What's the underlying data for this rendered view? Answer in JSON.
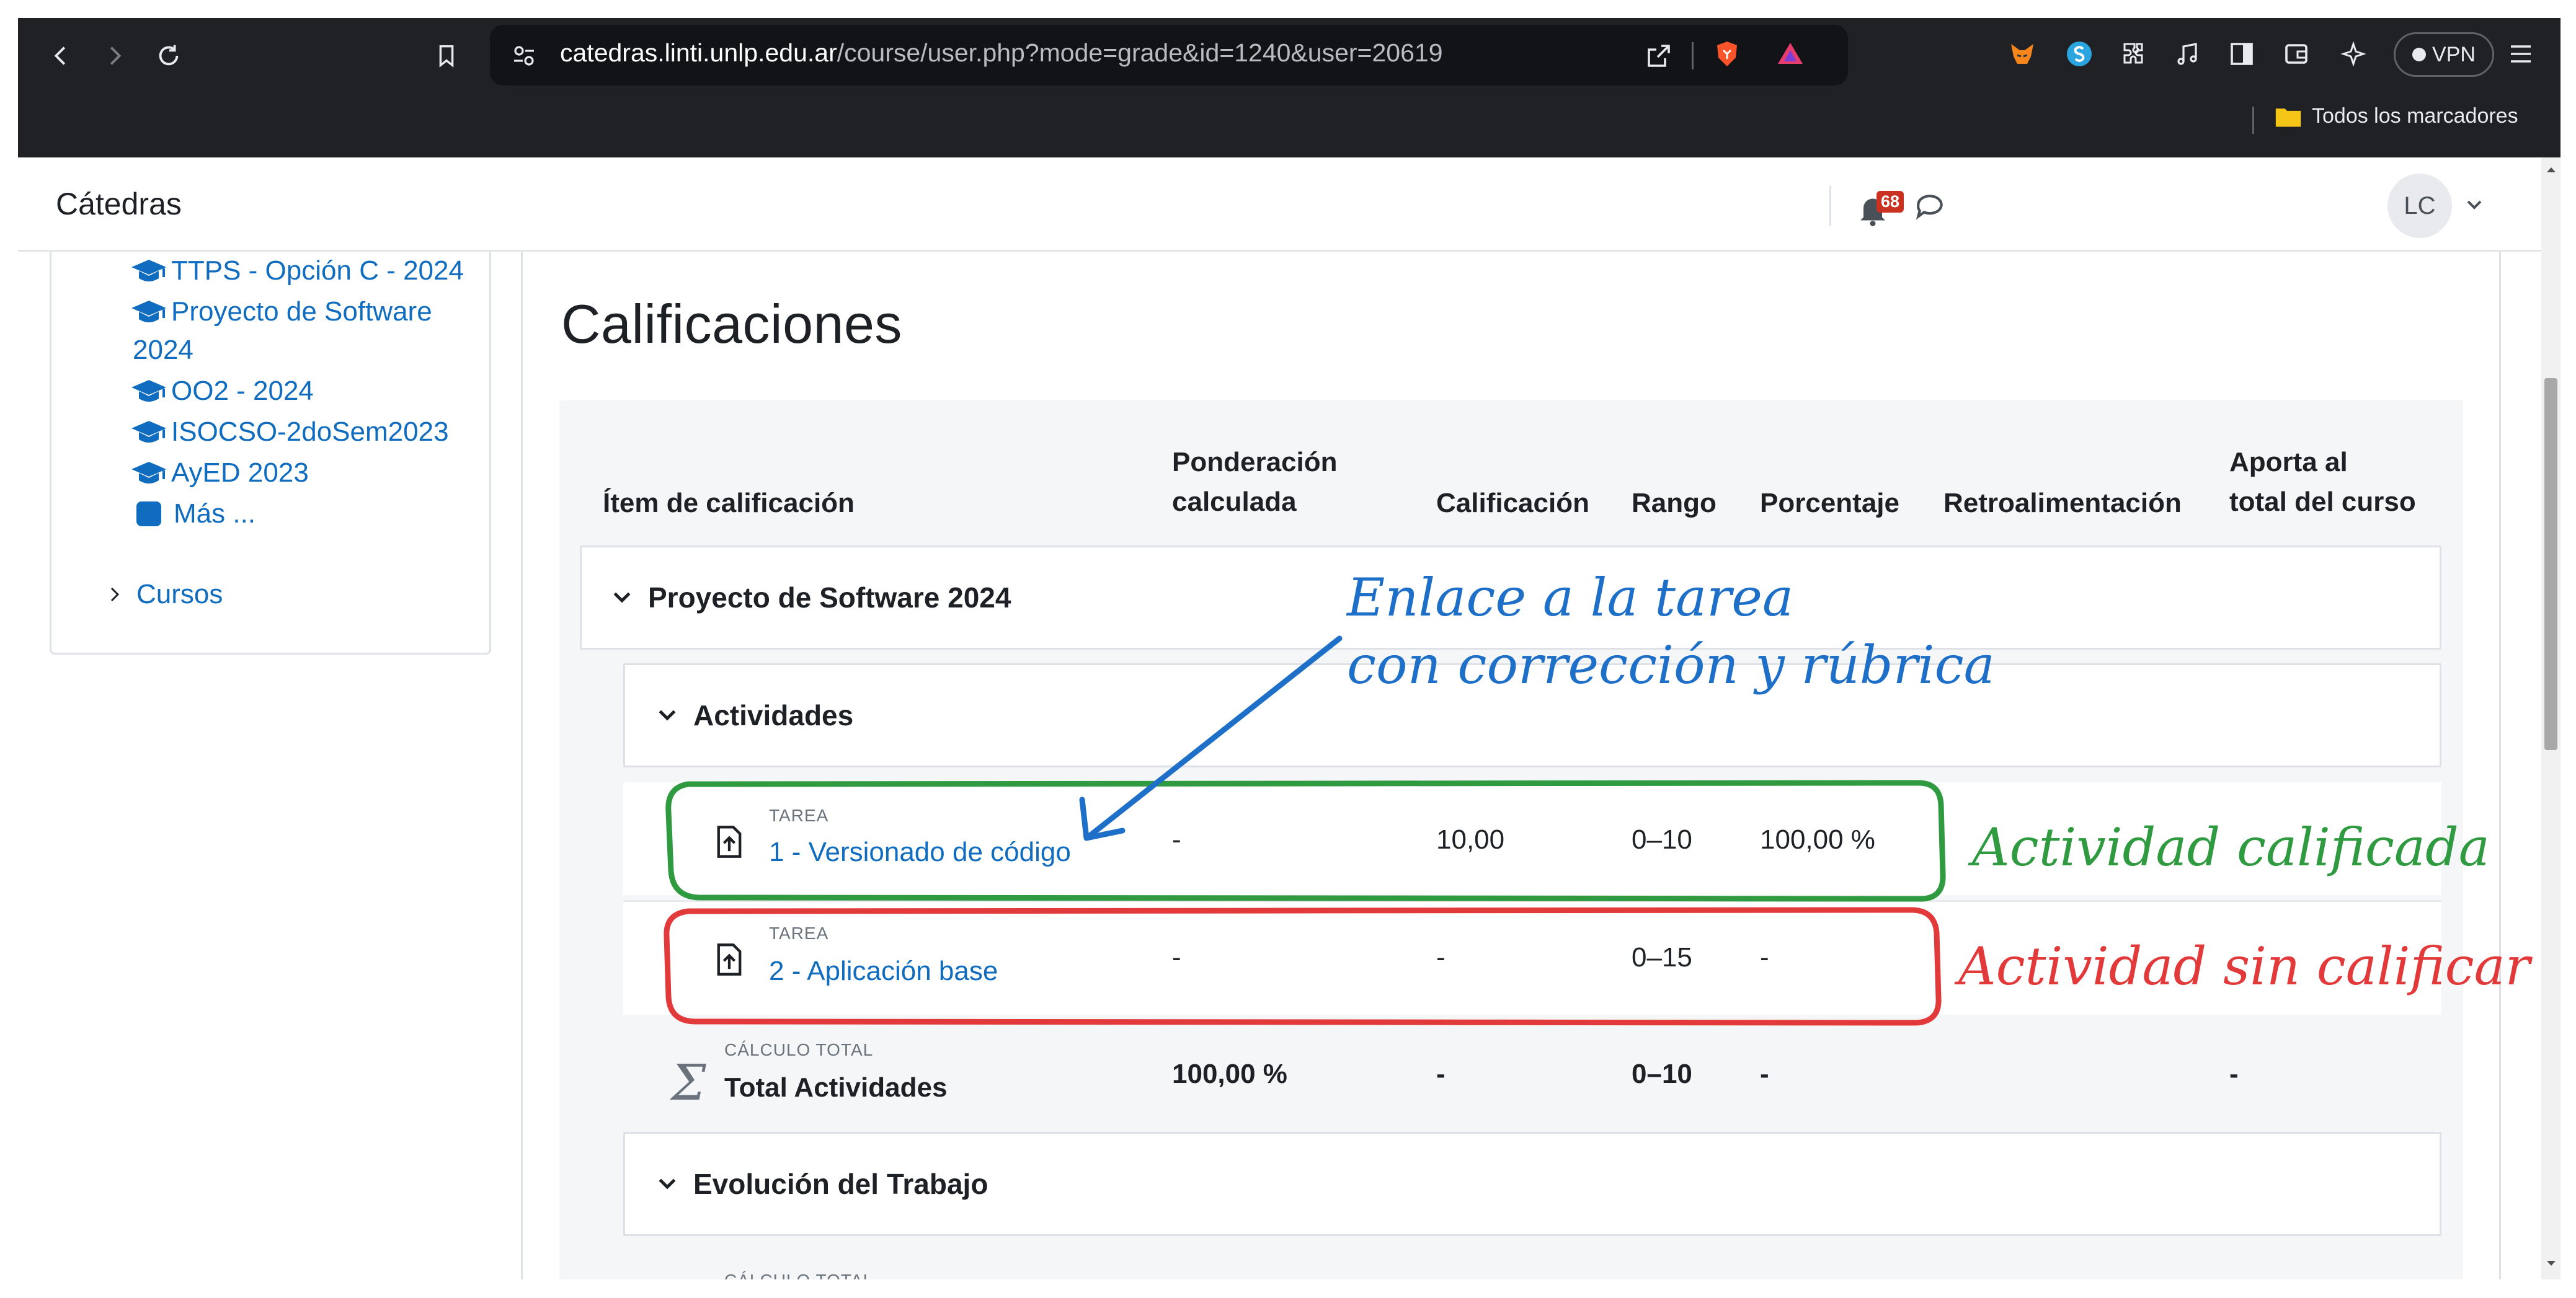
{
  "browser": {
    "url_host": "catedras.linti.unlp.edu.ar",
    "url_path": "/course/user.php?mode=grade&id=1240&user=20619",
    "vpn_label": "VPN",
    "bookmarks_label": "Todos los marcadores"
  },
  "header": {
    "site_name": "Cátedras",
    "notification_count": "68",
    "user_initials": "LC"
  },
  "drawer": {
    "courses": [
      {
        "label": "TTPS - Opción C - 2024"
      },
      {
        "label_line1": "Proyecto de Software",
        "label_line2": "2024"
      },
      {
        "label": "OO2 - 2024"
      },
      {
        "label": "ISOCSO-2doSem2023"
      },
      {
        "label": "AyED 2023"
      }
    ],
    "more_label": "Más ...",
    "cursos_label": "Cursos"
  },
  "page": {
    "title": "Calificaciones"
  },
  "table": {
    "headers": {
      "item": "Ítem de calificación",
      "weight_line1": "Ponderación",
      "weight_line2": "calculada",
      "grade": "Calificación",
      "range": "Rango",
      "percentage": "Porcentaje",
      "feedback": "Retroalimentación",
      "contrib_line1": "Aporta al",
      "contrib_line2": "total del curso"
    },
    "course_category": "Proyecto de Software 2024",
    "activities_category": "Actividades",
    "items": [
      {
        "type": "TAREA",
        "name": "1 - Versionado de código",
        "weight": "-",
        "grade": "10,00",
        "range": "0–10",
        "percentage": "100,00 %"
      },
      {
        "type": "TAREA",
        "name": "2 - Aplicación base",
        "weight": "-",
        "grade": "-",
        "range": "0–15",
        "percentage": "-"
      }
    ],
    "total": {
      "type": "CÁLCULO TOTAL",
      "name": "Total Actividades",
      "weight": "100,00 %",
      "grade": "-",
      "range": "0–10",
      "percentage": "-",
      "contrib": "-"
    },
    "evolution_category": "Evolución del Trabajo",
    "cut_label": "CÁLCULO TOTAL"
  },
  "annotations": {
    "link_line1": "Enlace a la tarea",
    "link_line2": "con corrección y rúbrica",
    "graded": "Actividad calificada",
    "ungraded": "Actividad sin calificar",
    "colors": {
      "blue": "#1e6fc8",
      "green": "#2f9a40",
      "red": "#e23a3a"
    }
  },
  "icons": [
    "back-icon",
    "forward-icon",
    "reload-icon",
    "bookmark-icon",
    "site-info-icon",
    "share-icon",
    "brave-shield-icon",
    "brave-rewards-icon",
    "metamask-icon",
    "extension-s-icon",
    "puzzle-icon",
    "music-icon",
    "sidebar-icon",
    "wallet-icon",
    "leo-icon",
    "menu-icon",
    "folder-icon",
    "bell-icon",
    "chat-icon",
    "chevron-down-icon",
    "graduation-cap-icon",
    "assignment-icon",
    "sigma-icon"
  ]
}
